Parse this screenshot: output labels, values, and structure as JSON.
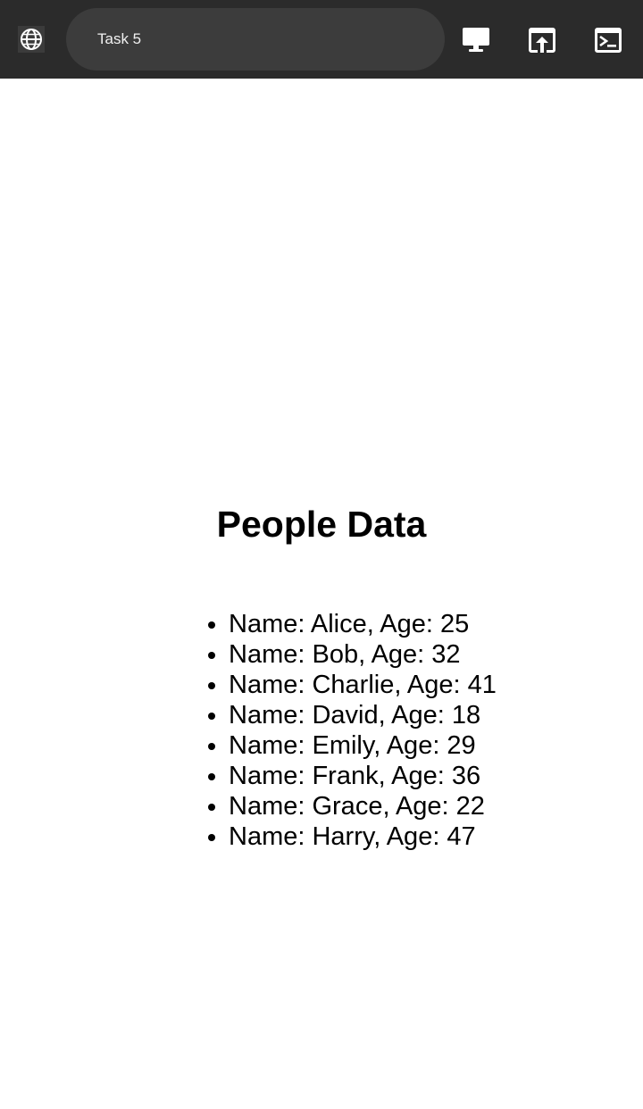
{
  "toolbar": {
    "address_text": "Task 5",
    "icons": [
      "globe-icon",
      "desktop-icon",
      "open-in-browser-icon",
      "terminal-icon"
    ]
  },
  "page": {
    "title": "People Data",
    "people": [
      "Name: Alice, Age: 25",
      "Name: Bob, Age: 32",
      "Name: Charlie, Age: 41",
      "Name: David, Age: 18",
      "Name: Emily, Age: 29",
      "Name: Frank, Age: 36",
      "Name: Grace, Age: 22",
      "Name: Harry, Age: 47"
    ]
  },
  "colors": {
    "toolbar_bg": "#2b2b2b",
    "address_bg": "#3c3c3c",
    "icon": "#ffffff",
    "page_bg": "#ffffff",
    "text": "#000000"
  }
}
